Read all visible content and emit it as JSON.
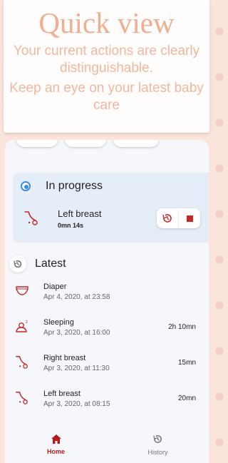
{
  "promo": {
    "title": "Quick view",
    "subtitle": "Your current actions are clearly distinguishable.",
    "subtitle2": "Keep an eye on your latest baby care"
  },
  "in_progress": {
    "title": "In progress",
    "item_name": "Left breast",
    "item_time": "0mn 14s"
  },
  "latest": {
    "title": "Latest",
    "items": [
      {
        "name": "Diaper",
        "date": "Apr 4, 2020, at 23:58",
        "duration": "",
        "icon": "diaper-icon"
      },
      {
        "name": "Sleeping",
        "date": "Apr 3, 2020, at 16:00",
        "duration": "2h 10mn",
        "icon": "sleep-icon"
      },
      {
        "name": "Right breast",
        "date": "Apr 3, 2020, at 11:30",
        "duration": "15mn",
        "icon": "breastfeeding-icon"
      },
      {
        "name": "Left breast",
        "date": "Apr 3, 2020, at 08:15",
        "duration": "20mn",
        "icon": "breastfeeding-icon"
      }
    ]
  },
  "nav": {
    "home": "Home",
    "history": "History"
  },
  "colors": {
    "accent": "#c62828",
    "promo_text": "#f1ad92",
    "in_progress_bg": "#e5eef8"
  }
}
